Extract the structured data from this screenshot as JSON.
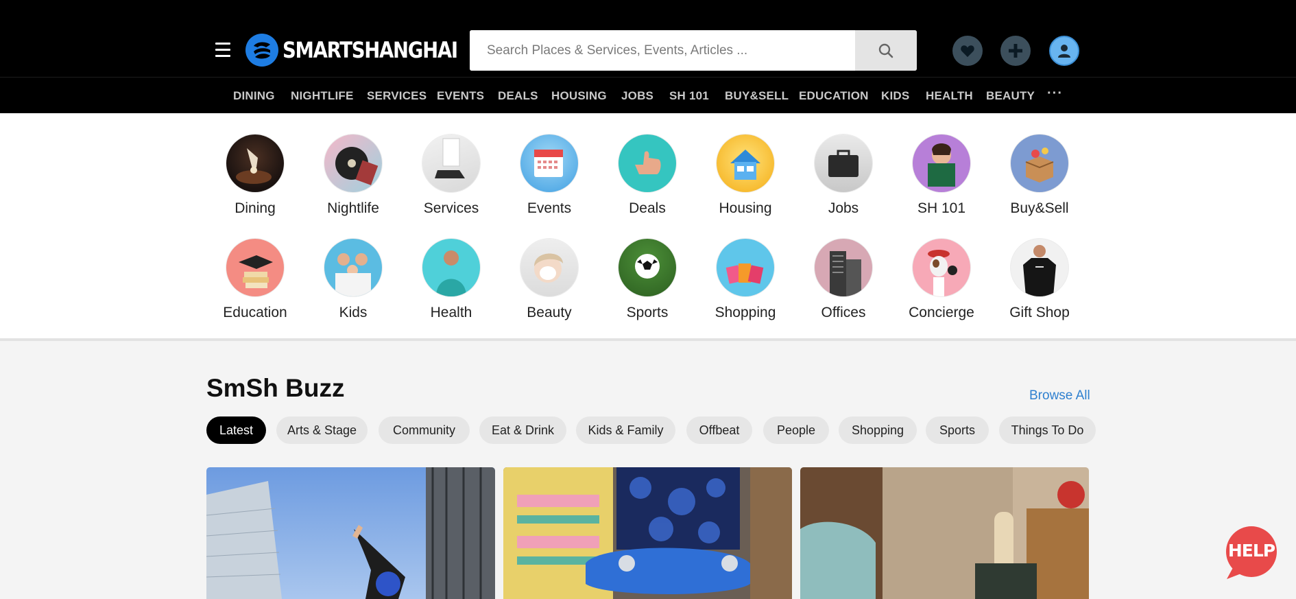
{
  "header": {
    "logo_text": "SMARTSHANGHAI",
    "search_placeholder": "Search Places & Services, Events, Articles ..."
  },
  "category_nav": {
    "items": [
      "DINING",
      "NIGHTLIFE",
      "SERVICES",
      "EVENTS",
      "DEALS",
      "HOUSING",
      "JOBS",
      "SH 101",
      "BUY&SELL",
      "EDUCATION",
      "KIDS",
      "HEALTH",
      "BEAUTY"
    ],
    "more_label": "···"
  },
  "category_grid": {
    "row1": [
      "Dining",
      "Nightlife",
      "Services",
      "Events",
      "Deals",
      "Housing",
      "Jobs",
      "SH 101",
      "Buy&Sell"
    ],
    "row2": [
      "Education",
      "Kids",
      "Health",
      "Beauty",
      "Sports",
      "Shopping",
      "Offices",
      "Concierge",
      "Gift Shop"
    ]
  },
  "buzz": {
    "title": "SmSh Buzz",
    "browse_all": "Browse All",
    "filters": [
      "Latest",
      "Arts & Stage",
      "Community",
      "Eat & Drink",
      "Kids & Family",
      "Offbeat",
      "People",
      "Shopping",
      "Sports",
      "Things To Do"
    ],
    "active_filter": "Latest"
  },
  "help_label": "HELP",
  "colors": {
    "brand_blue": "#1e7de3",
    "link_blue": "#2f80cf",
    "help_red": "#e84a4a",
    "header_bg": "#000000"
  }
}
